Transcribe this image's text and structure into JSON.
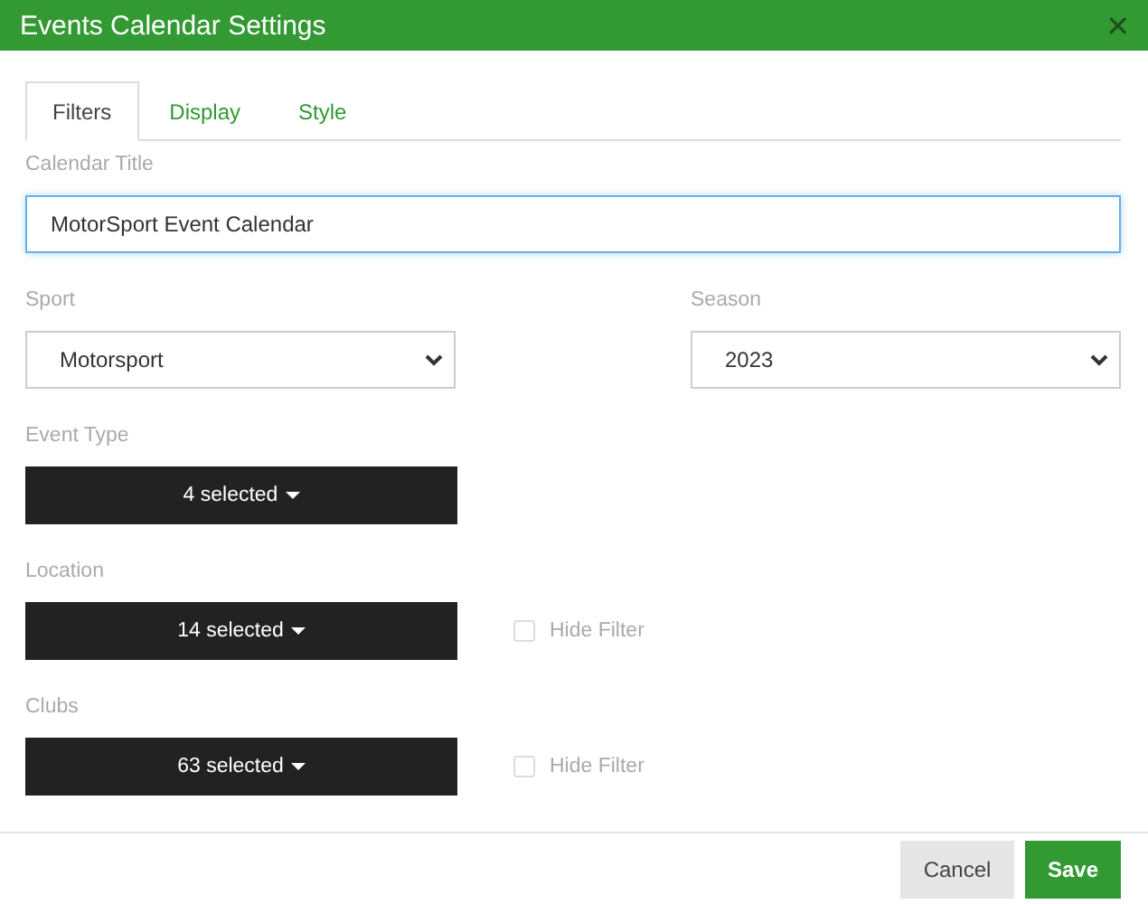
{
  "window": {
    "title": "Events Calendar Settings",
    "close": "✕"
  },
  "tabs": [
    {
      "label": "Filters",
      "selected": true
    },
    {
      "label": "Display",
      "selected": false
    },
    {
      "label": "Style",
      "selected": false
    }
  ],
  "calendar_title": {
    "label": "Calendar Title",
    "value": "MotorSport Event Calendar"
  },
  "selects": [
    {
      "label": "Sport",
      "value": "Motorsport"
    },
    {
      "label": "Season",
      "value": "2023"
    }
  ],
  "filters": [
    {
      "label": "Event Type",
      "value": "4 selected"
    },
    {
      "label": "Location",
      "value": "14 selected",
      "hide_filter": {
        "label": "Hide Filter",
        "checked": false
      }
    },
    {
      "label": "Clubs",
      "value": "63 selected",
      "hide_filter": {
        "label": "Hide Filter",
        "checked": false
      }
    }
  ],
  "buttons": [
    {
      "label": "Cancel",
      "kind": "secondary"
    },
    {
      "label": "Save",
      "kind": "primary"
    }
  ]
}
